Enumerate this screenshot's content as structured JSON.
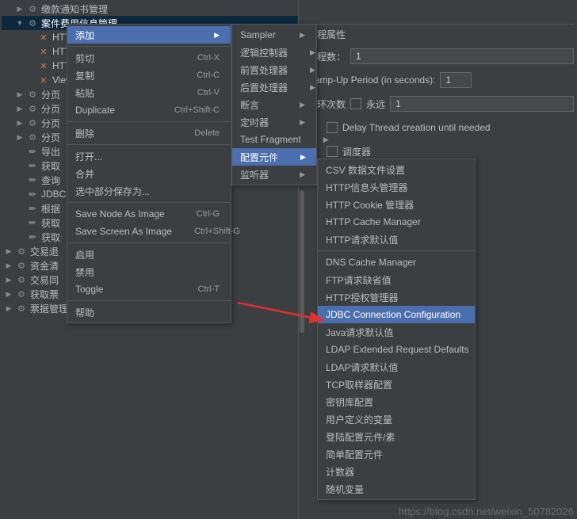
{
  "tree": [
    {
      "indent": 1,
      "twisty": "▶",
      "icon": "gear",
      "label": "缴款通知书管理",
      "sel": false
    },
    {
      "indent": 1,
      "twisty": "▼",
      "icon": "gear",
      "label": "案件费用信息管理",
      "sel": true
    },
    {
      "indent": 2,
      "twisty": "",
      "icon": "tools",
      "label": "HTTP",
      "sel": false
    },
    {
      "indent": 2,
      "twisty": "",
      "icon": "tools",
      "label": "HTTP",
      "sel": false
    },
    {
      "indent": 2,
      "twisty": "",
      "icon": "tools",
      "label": "HTTP",
      "sel": false
    },
    {
      "indent": 2,
      "twisty": "",
      "icon": "tools",
      "label": "View",
      "sel": false
    },
    {
      "indent": 1,
      "twisty": "▶",
      "icon": "gear",
      "label": "分页",
      "sel": false
    },
    {
      "indent": 1,
      "twisty": "▶",
      "icon": "gear",
      "label": "分页",
      "sel": false
    },
    {
      "indent": 1,
      "twisty": "▶",
      "icon": "gear",
      "label": "分页",
      "sel": false
    },
    {
      "indent": 1,
      "twisty": "▶",
      "icon": "gear",
      "label": "分页",
      "sel": false
    },
    {
      "indent": 1,
      "twisty": "",
      "icon": "pencil",
      "label": "导出",
      "sel": false
    },
    {
      "indent": 1,
      "twisty": "",
      "icon": "pencil",
      "label": "获取",
      "sel": false
    },
    {
      "indent": 1,
      "twisty": "",
      "icon": "pencil",
      "label": "查询",
      "sel": false
    },
    {
      "indent": 1,
      "twisty": "",
      "icon": "pencil",
      "label": "JDBC",
      "sel": false
    },
    {
      "indent": 1,
      "twisty": "",
      "icon": "pencil",
      "label": "根据",
      "sel": false
    },
    {
      "indent": 1,
      "twisty": "",
      "icon": "pencil",
      "label": "获取",
      "sel": false
    },
    {
      "indent": 1,
      "twisty": "",
      "icon": "pencil",
      "label": "获取",
      "sel": false
    },
    {
      "indent": 0,
      "twisty": "▶",
      "icon": "gear",
      "label": "交易退",
      "sel": false
    },
    {
      "indent": 0,
      "twisty": "▶",
      "icon": "gear",
      "label": "资金清",
      "sel": false
    },
    {
      "indent": 0,
      "twisty": "▶",
      "icon": "gear",
      "label": "交易同",
      "sel": false
    },
    {
      "indent": 0,
      "twisty": "▶",
      "icon": "gear",
      "label": "获取票",
      "sel": false
    },
    {
      "indent": 0,
      "twisty": "▶",
      "icon": "gear",
      "label": "票据管理",
      "sel": false
    }
  ],
  "ctx1": [
    {
      "type": "item",
      "label": "添加",
      "shortcut": "",
      "arrow": true,
      "hl": true
    },
    {
      "type": "sep"
    },
    {
      "type": "item",
      "label": "剪切",
      "shortcut": "Ctrl-X"
    },
    {
      "type": "item",
      "label": "复制",
      "shortcut": "Ctrl-C"
    },
    {
      "type": "item",
      "label": "粘贴",
      "shortcut": "Ctrl-V"
    },
    {
      "type": "item",
      "label": "Duplicate",
      "shortcut": "Ctrl+Shift-C"
    },
    {
      "type": "sep"
    },
    {
      "type": "item",
      "label": "删除",
      "shortcut": "Delete"
    },
    {
      "type": "sep"
    },
    {
      "type": "item",
      "label": "打开...",
      "shortcut": ""
    },
    {
      "type": "item",
      "label": "合并",
      "shortcut": ""
    },
    {
      "type": "item",
      "label": "选中部分保存为...",
      "shortcut": ""
    },
    {
      "type": "sep"
    },
    {
      "type": "item",
      "label": "Save Node As Image",
      "shortcut": "Ctrl-G"
    },
    {
      "type": "item",
      "label": "Save Screen As Image",
      "shortcut": "Ctrl+Shift-G"
    },
    {
      "type": "sep"
    },
    {
      "type": "item",
      "label": "启用",
      "shortcut": ""
    },
    {
      "type": "item",
      "label": "禁用",
      "shortcut": ""
    },
    {
      "type": "item",
      "label": "Toggle",
      "shortcut": "Ctrl-T"
    },
    {
      "type": "sep"
    },
    {
      "type": "item",
      "label": "帮助",
      "shortcut": ""
    }
  ],
  "ctx2": [
    {
      "label": "Sampler",
      "arrow": true
    },
    {
      "label": "逻辑控制器",
      "arrow": true
    },
    {
      "label": "前置处理器",
      "arrow": true
    },
    {
      "label": "后置处理器",
      "arrow": true
    },
    {
      "label": "断言",
      "arrow": true
    },
    {
      "label": "定时器",
      "arrow": true
    },
    {
      "label": "Test Fragment",
      "arrow": true
    },
    {
      "label": "配置元件",
      "arrow": true,
      "hl": true
    },
    {
      "label": "监听器",
      "arrow": true
    }
  ],
  "ctx3": [
    {
      "type": "item",
      "label": "CSV 数据文件设置"
    },
    {
      "type": "item",
      "label": "HTTP信息头管理器"
    },
    {
      "type": "item",
      "label": "HTTP Cookie 管理器"
    },
    {
      "type": "item",
      "label": "HTTP Cache Manager"
    },
    {
      "type": "item",
      "label": "HTTP请求默认值"
    },
    {
      "type": "sep"
    },
    {
      "type": "item",
      "label": "DNS Cache Manager"
    },
    {
      "type": "item",
      "label": "FTP请求缺省值"
    },
    {
      "type": "item",
      "label": "HTTP授权管理器"
    },
    {
      "type": "item",
      "label": "JDBC Connection Configuration",
      "hl": true
    },
    {
      "type": "item",
      "label": "Java请求默认值"
    },
    {
      "type": "item",
      "label": "LDAP Extended Request Defaults"
    },
    {
      "type": "item",
      "label": "LDAP请求默认值"
    },
    {
      "type": "item",
      "label": "TCP取样器配置"
    },
    {
      "type": "item",
      "label": "密钥库配置"
    },
    {
      "type": "item",
      "label": "用户定义的变量"
    },
    {
      "type": "item",
      "label": "登陆配置元件/素"
    },
    {
      "type": "item",
      "label": "简单配置元件"
    },
    {
      "type": "item",
      "label": "计数器"
    },
    {
      "type": "item",
      "label": "随机变量"
    }
  ],
  "form": {
    "fieldset_title": "线程属性",
    "threads_label": "线程数：",
    "threads_value": "1",
    "rampup_label": "Ramp-Up Period (in seconds):",
    "rampup_value": "1",
    "loop_label": "循环次数",
    "forever_label": "永远",
    "loop_value": "1",
    "delay_label": "Delay Thread creation until needed",
    "scheduler_label": "调度器"
  },
  "watermark": "https://blog.csdn.net/weixin_50782026"
}
